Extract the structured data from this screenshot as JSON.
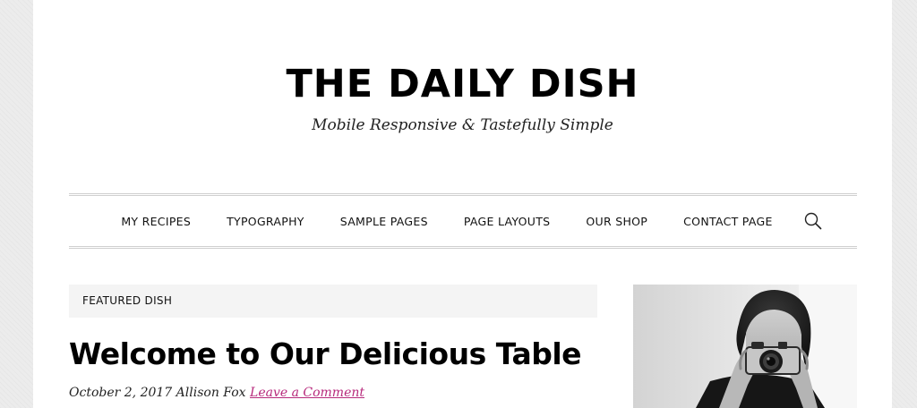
{
  "site": {
    "title": "THE DAILY DISH",
    "tagline": "Mobile Responsive & Tastefully Simple"
  },
  "nav": {
    "items": [
      {
        "label": "MY RECIPES"
      },
      {
        "label": "TYPOGRAPHY"
      },
      {
        "label": "SAMPLE PAGES"
      },
      {
        "label": "PAGE LAYOUTS"
      },
      {
        "label": "OUR SHOP"
      },
      {
        "label": "CONTACT PAGE"
      }
    ],
    "search_icon": "search-icon"
  },
  "featured": {
    "label": "FEATURED DISH"
  },
  "post": {
    "title": "Welcome to Our Delicious Table",
    "date": "October 2, 2017",
    "author": "Allison Fox",
    "comment_link": "Leave a Comment"
  },
  "colors": {
    "link": "#b72a7c",
    "featured_bg": "#f4f4f4",
    "border": "#cfcfcf"
  }
}
